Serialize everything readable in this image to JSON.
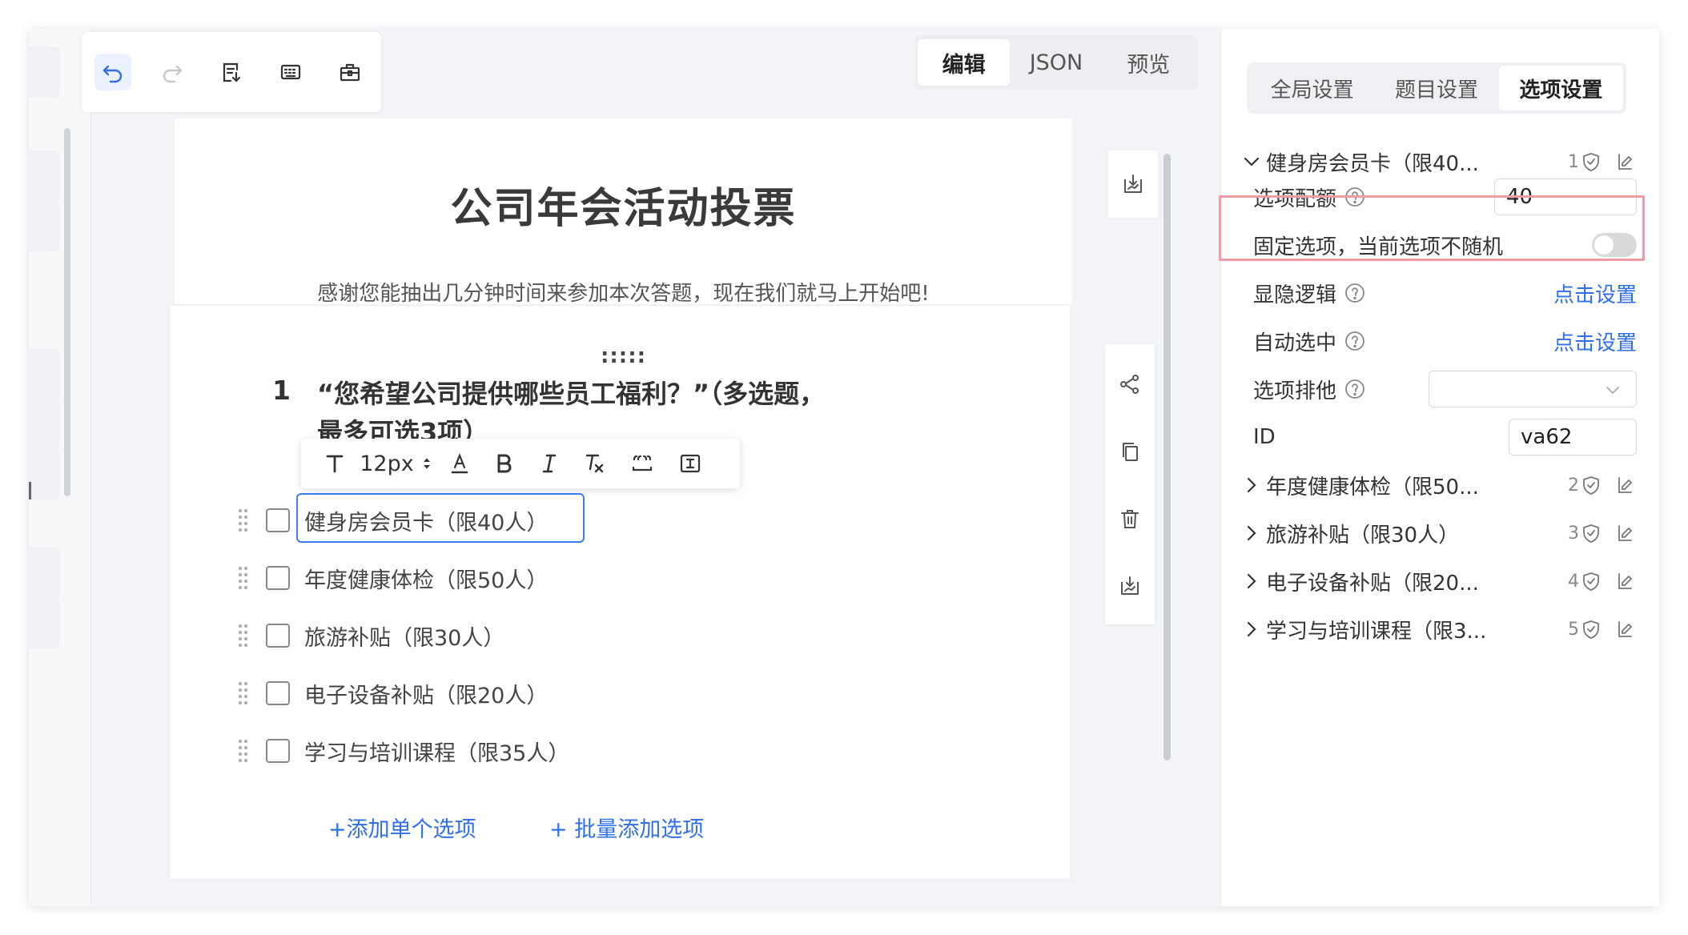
{
  "toolbar": {
    "buttons": [
      {
        "icon": "undo-icon"
      },
      {
        "icon": "redo-icon"
      },
      {
        "icon": "import-doc-icon"
      },
      {
        "icon": "keyboard-icon"
      },
      {
        "icon": "toolbox-icon"
      }
    ]
  },
  "mode_tabs": [
    "编辑",
    "JSON",
    "预览"
  ],
  "survey": {
    "title": "公司年会活动投票",
    "description": "感谢您能抽出几分钟时间来参加本次答题，现在我们就马上开始吧!"
  },
  "question": {
    "drag_handle": ":::::",
    "number": "1",
    "text": "“您希望公司提供哪些员工福利？”（多选题，最多可选3项）",
    "options": [
      "健身房会员卡（限40人）",
      "年度健康体检（限50人）",
      "旅游补贴（限30人）",
      "电子设备补贴（限20人）",
      "学习与培训课程（限35人）"
    ],
    "add_single": "+添加单个选项",
    "add_batch": "+ 批量添加选项"
  },
  "format_bar": {
    "font_size": "12px",
    "items": [
      "text-style-icon",
      "font-color-icon",
      "bold-icon",
      "italic-icon",
      "clear-format-icon",
      "quote-icon",
      "insert-blank-icon"
    ]
  },
  "panel": {
    "tabs": [
      "全局设置",
      "题目设置",
      "选项设置"
    ],
    "expanded_option": {
      "label": "健身房会员卡（限40...",
      "index": "1"
    },
    "quota_label": "选项配额",
    "quota_value": "40",
    "fixed_label": "固定选项，当前选项不随机",
    "logic_label": "显隐逻辑",
    "logic_link": "点击设置",
    "auto_label": "自动选中",
    "auto_link": "点击设置",
    "exclusive_label": "选项排他",
    "id_label": "ID",
    "id_value": "va62",
    "collapsed_options": [
      {
        "label": "年度健康体检（限50...",
        "index": "2"
      },
      {
        "label": "旅游补贴（限30人）",
        "index": "3"
      },
      {
        "label": "电子设备补贴（限20...",
        "index": "4"
      },
      {
        "label": "学习与培训课程（限3...",
        "index": "5"
      }
    ]
  },
  "colors": {
    "accent": "#2f6fe8",
    "highlight_border": "#f29ba4",
    "background": "#f3f4f7"
  }
}
